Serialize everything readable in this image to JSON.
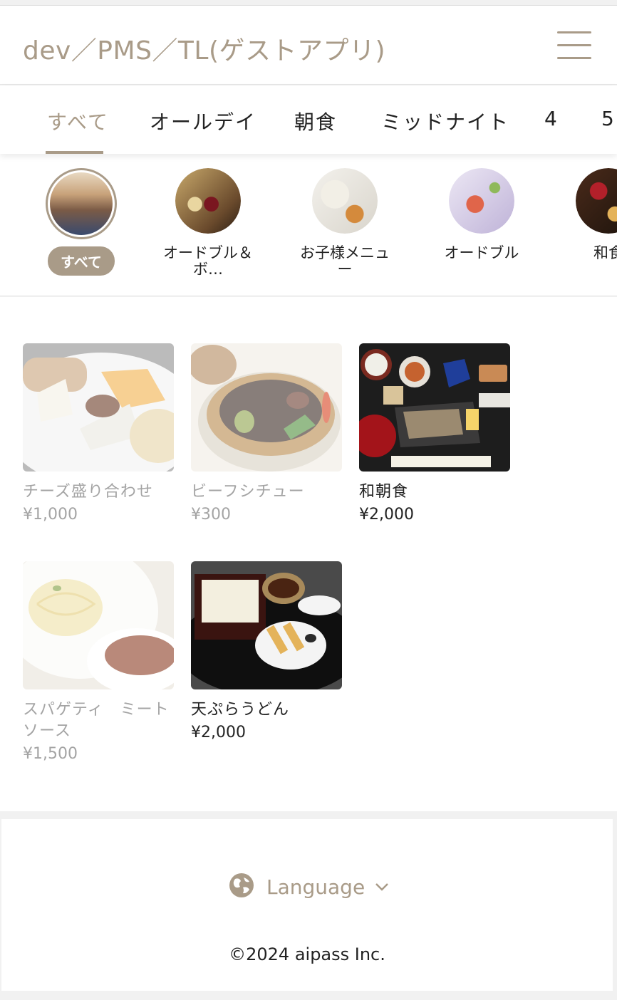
{
  "header": {
    "title": "dev／PMS／TL(ゲストアプリ)"
  },
  "tabs": [
    {
      "label": "すべて",
      "active": true
    },
    {
      "label": "オールデイ",
      "active": false
    },
    {
      "label": "朝食",
      "active": false
    },
    {
      "label": "ミッドナイト",
      "active": false
    },
    {
      "label": "4",
      "active": false
    },
    {
      "label": "5",
      "active": false
    }
  ],
  "categories": [
    {
      "label": "すべて",
      "selected": true
    },
    {
      "label": "オードブル＆ボ…",
      "selected": false
    },
    {
      "label": "お子様メニュー",
      "selected": false
    },
    {
      "label": "オードブル",
      "selected": false
    },
    {
      "label": "和食",
      "selected": false
    }
  ],
  "items": [
    {
      "name": "チーズ盛り合わせ",
      "price": "¥1,000",
      "available": false
    },
    {
      "name": "ビーフシチュー",
      "price": "¥300",
      "available": false
    },
    {
      "name": "和朝食",
      "price": "¥2,000",
      "available": true
    },
    {
      "name": "スパゲティ　ミートソース",
      "price": "¥1,500",
      "available": false
    },
    {
      "name": "天ぷらうどん",
      "price": "¥2,000",
      "available": true
    }
  ],
  "footer": {
    "language_label": "Language",
    "copyright": "©2024 aipass Inc."
  },
  "colors": {
    "accent": "#a99b88",
    "text": "#222222",
    "disabled_text": "#a4a4a4"
  }
}
